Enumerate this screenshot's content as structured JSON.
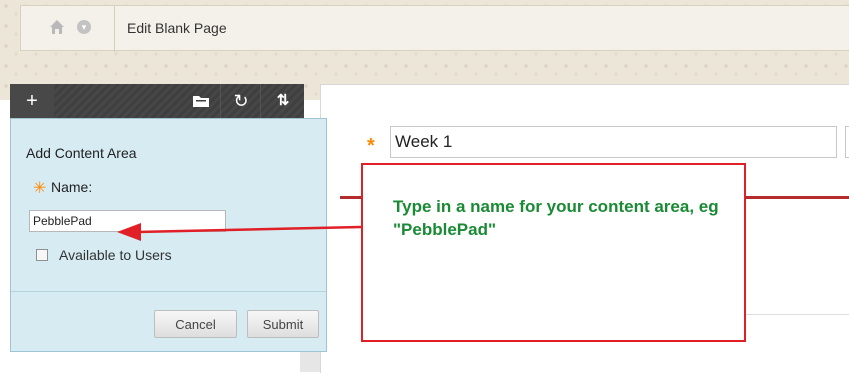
{
  "breadcrumb": {
    "home_icon": "home-icon",
    "expand_icon": "chevron-down-icon",
    "title": "Edit Blank Page"
  },
  "toolbar": {
    "add_icon": "plus-icon",
    "add_glyph": "+",
    "folder_icon": "folder-icon",
    "refresh_icon": "refresh-icon",
    "refresh_glyph": "↻",
    "sort_icon": "sort-icon",
    "sort_glyph": "⇅"
  },
  "popup": {
    "title": "Add Content Area",
    "name_required_mark": "✳",
    "name_label": "Name:",
    "name_value": "PebblePad",
    "available_label": "Available to Users",
    "available_checked": false,
    "cancel_label": "Cancel",
    "submit_label": "Submit"
  },
  "main": {
    "required_mark": "*",
    "title_value": "Week 1"
  },
  "callout": {
    "text": "Type in a name for your content area, eg \"PebblePad\"",
    "border_color": "#e01f26",
    "text_color": "#1a8a35"
  },
  "colors": {
    "accent_required": "#ff8a00",
    "popup_bg": "#d6ebf2",
    "toolbar_bg": "#3f3f3f",
    "rule_red": "#b32b2b"
  }
}
